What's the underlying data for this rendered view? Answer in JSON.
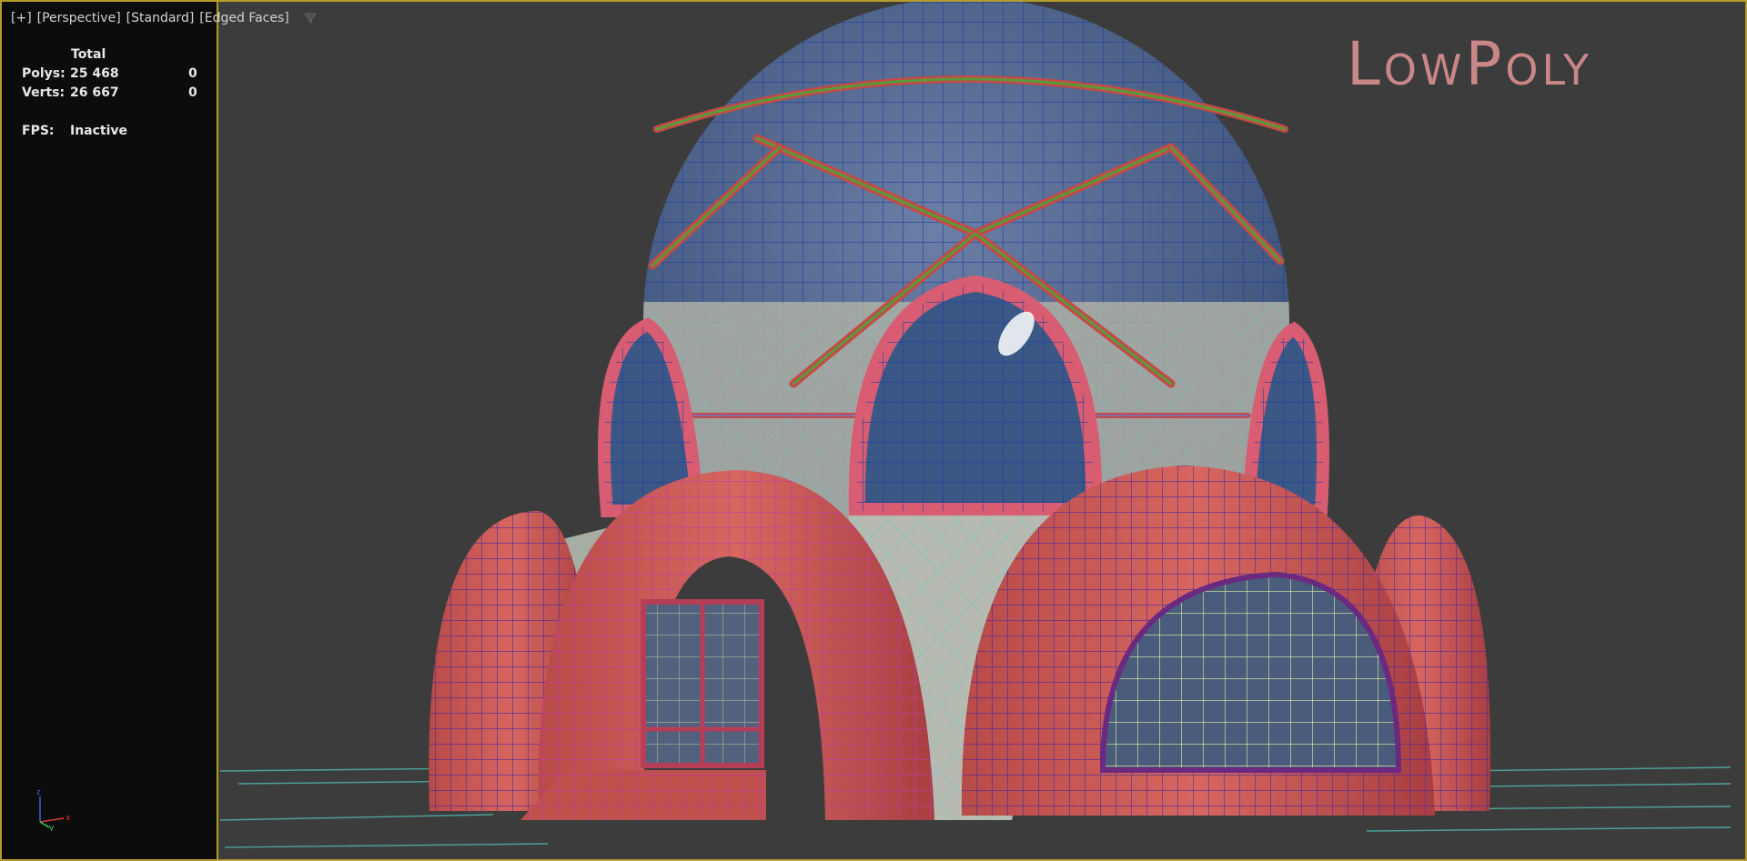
{
  "viewport": {
    "label_parts": [
      "[+]",
      "[Perspective]",
      "[Standard]",
      "[Edged Faces]"
    ],
    "filter_icon": "funnel-icon"
  },
  "stats": {
    "header": "Total",
    "polys_label": "Polys:",
    "polys_value": "25 468",
    "polys_selected": "0",
    "verts_label": "Verts:",
    "verts_value": "26 667",
    "verts_selected": "0",
    "fps_label": "FPS:",
    "fps_value": "Inactive"
  },
  "watermark": "LowPoly",
  "axis_gizmo": {
    "x": "x",
    "y": "y",
    "z": "z"
  },
  "colors": {
    "viewport_border": "#b59a2c",
    "viewport_bg": "#3c3c3c",
    "stats_bg": "#0c0c0c",
    "watermark": "#c98787",
    "brick": "#c9564f",
    "dome": "#4a5f86",
    "wire_blue": "#1f3f9f",
    "wire_green": "#5a9a3a",
    "wire_cyan": "#6ec9c0"
  }
}
